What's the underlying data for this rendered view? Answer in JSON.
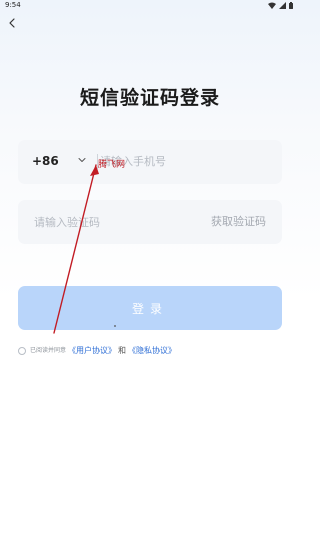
{
  "status_bar": {
    "time": "9:54"
  },
  "page": {
    "title": "短信验证码登录"
  },
  "phone": {
    "country_code": "+86",
    "placeholder": "请输入手机号"
  },
  "code": {
    "placeholder": "请输入验证码",
    "get_code_label": "获取验证码"
  },
  "login": {
    "label": "登录"
  },
  "agreement": {
    "prefix": "已阅读并同意",
    "user_agreement": "《用户协议》",
    "and": "和",
    "privacy_policy": "《隐私协议》"
  },
  "watermark": {
    "text": "腾飞网"
  },
  "colors": {
    "accent": "#2f6fd6",
    "button_bg": "#b9d5fa",
    "annotation_red": "#c21c24"
  }
}
